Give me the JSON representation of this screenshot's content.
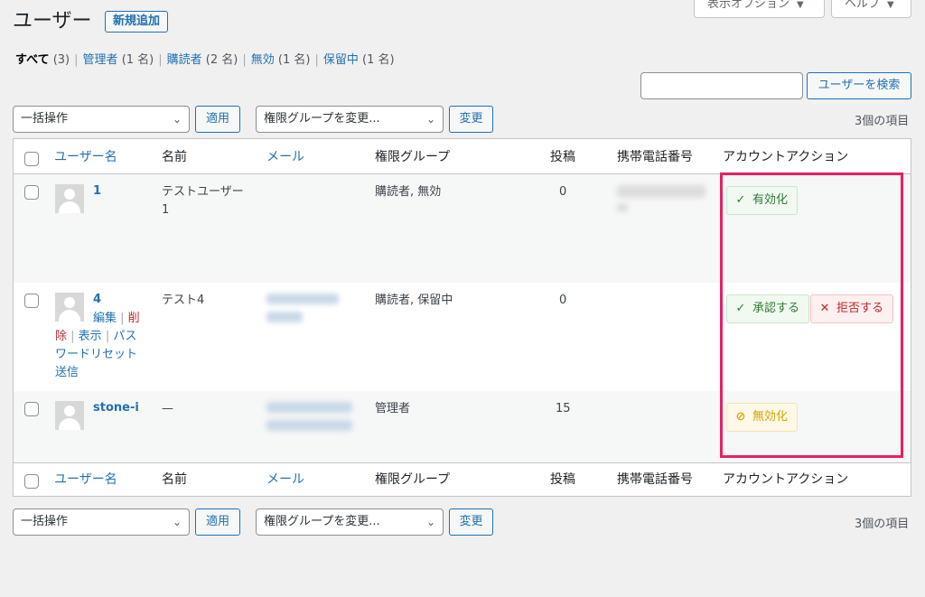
{
  "header": {
    "title": "ユーザー",
    "add_new": "新規追加",
    "screen_options": "表示オプション",
    "help": "ヘルプ"
  },
  "filters": [
    {
      "label": "すべて",
      "count": "(3)",
      "current": true
    },
    {
      "label": "管理者",
      "count": "(1 名)"
    },
    {
      "label": "購読者",
      "count": "(2 名)"
    },
    {
      "label": "無効",
      "count": "(1 名)"
    },
    {
      "label": "保留中",
      "count": "(1 名)"
    }
  ],
  "search": {
    "button": "ユーザーを検索",
    "value": ""
  },
  "tablenav": {
    "bulk_select": "一括操作",
    "apply": "適用",
    "role_select": "権限グループを変更...",
    "change": "変更",
    "items": "3個の項目"
  },
  "columns": {
    "username": "ユーザー名",
    "name": "名前",
    "email": "メール",
    "role": "権限グループ",
    "posts": "投稿",
    "phone": "携帯電話番号",
    "actions": "アカウントアクション"
  },
  "rows": [
    {
      "username": "1",
      "name_line1": "テストユーザー",
      "name_line2": "1",
      "role": "購読者, 無効",
      "posts": "0",
      "action1": "有効化"
    },
    {
      "username": "4",
      "name_line1": "テスト4",
      "role": "購読者, 保留中",
      "posts": "0",
      "row_actions": {
        "edit": "編集",
        "delete_1": "削",
        "delete_2": "除",
        "view": "表示",
        "reset_1": "パス",
        "reset_2": "ワードリセット",
        "reset_3": "送信"
      },
      "action1": "承認する",
      "action2": "拒否する"
    },
    {
      "username": "stone-i",
      "name_line1": "—",
      "role": "管理者",
      "posts": "15",
      "action1": "無効化"
    }
  ],
  "colors": {
    "accent": "#2271b1",
    "highlight": "#e91e63",
    "approve": "#2e7d32",
    "reject": "#c62828",
    "disable": "#d9a600"
  }
}
